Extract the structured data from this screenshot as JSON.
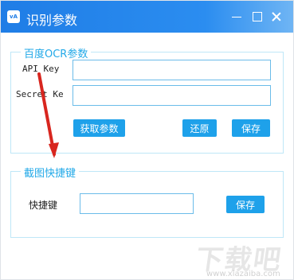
{
  "window": {
    "title": "识别参数",
    "app_icon_text": "vA"
  },
  "sections": {
    "ocr": {
      "title": "百度OCR参数",
      "api_key_label": "API Key",
      "secret_key_label": "Secret Ke",
      "buttons": {
        "get_params": "获取参数",
        "reset": "还原",
        "save": "保存"
      }
    },
    "shortcut": {
      "title": "截图快捷键",
      "label": "快捷键",
      "save": "保存"
    }
  },
  "watermark": {
    "main": "下载吧",
    "sub": "www.xiazaiba.com"
  },
  "colors": {
    "titlebar": "#1f7de6",
    "accent": "#1ea1ea",
    "group_border": "#bfe7f7",
    "arrow": "#d8261f"
  }
}
